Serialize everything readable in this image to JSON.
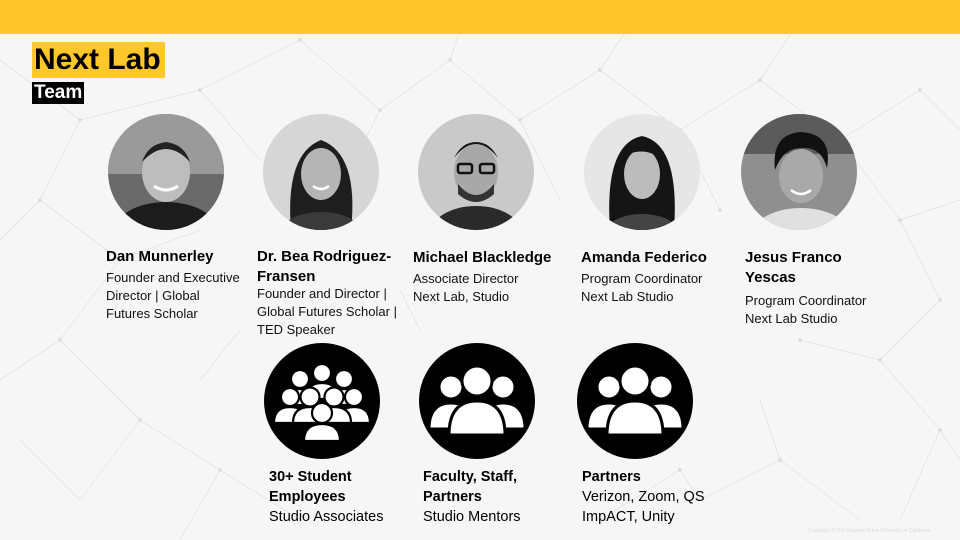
{
  "header": {
    "title": "Next Lab",
    "subtitle": "Team"
  },
  "team": [
    {
      "name": "Dan Munnerley",
      "role_lines": [
        "Founder and Executive",
        "Director | Global",
        "Futures Scholar"
      ]
    },
    {
      "name_lines": [
        "Dr. Bea Rodriguez-",
        "Fransen"
      ],
      "role_lines": [
        "Founder and Director |",
        "Global Futures Scholar |",
        "TED Speaker"
      ]
    },
    {
      "name": "Michael Blackledge",
      "role_lines": [
        "Associate Director",
        "Next Lab, Studio"
      ]
    },
    {
      "name": "Amanda Federico",
      "role_lines": [
        "Program Coordinator",
        "Next Lab Studio"
      ]
    },
    {
      "name_lines": [
        "Jesus Franco",
        "Yescas"
      ],
      "role_lines": [
        "Program Coordinator",
        "Next Lab Studio"
      ]
    }
  ],
  "groups": [
    {
      "title_lines": [
        "30+ Student",
        "Employees"
      ],
      "desc_lines": [
        "Studio Associates"
      ],
      "icon": "crowd-icon"
    },
    {
      "title_lines": [
        "Faculty, Staff,",
        "Partners"
      ],
      "desc_lines": [
        "Studio Mentors"
      ],
      "icon": "group-icon"
    },
    {
      "title_lines": [
        "Partners"
      ],
      "desc_lines": [
        "Verizon, Zoom, QS",
        "ImpACT, Unity"
      ],
      "icon": "group-icon"
    }
  ],
  "colors": {
    "accent": "#ffc72c",
    "text": "#000000",
    "background": "#f6f6f6"
  },
  "footer": {
    "copyright": "Copyright © The Regents of the University of California"
  }
}
